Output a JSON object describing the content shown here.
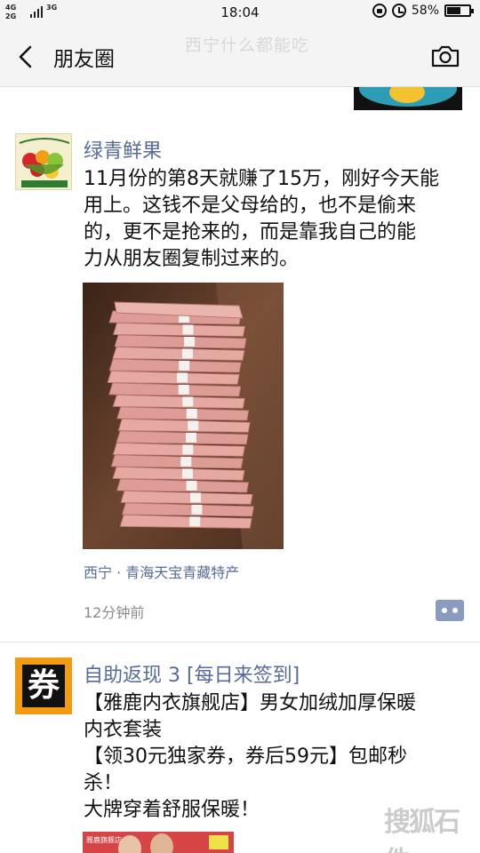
{
  "status_bar": {
    "network_top": "4G",
    "network_bottom": "2G",
    "network_alt": "3G",
    "time": "18:04",
    "battery": "58%",
    "battery_level": 0.58
  },
  "nav": {
    "title": "朋友圈",
    "ghost_text": "西宁什么都能吃",
    "back_icon": "chevron-left-icon",
    "camera_icon": "camera-icon"
  },
  "posts": [
    {
      "author": "绿青鲜果",
      "avatar_icon": "fruit-basket-avatar",
      "lines": [
        "11月份的第8天就赚了15万，刚好今天能",
        "用上。这钱不是父母给的，也不是偷来",
        "的，更不是抢来的，而是靠我自己的能",
        "力从朋友圈复制过来的。"
      ],
      "location": "西宁 · 青海天宝青藏特产",
      "time": "12分钟前"
    },
    {
      "author": "自助返现 3 [每日来签到]",
      "avatar_glyph": "券",
      "lines": [
        "【雅鹿内衣旗舰店】男女加绒加厚保暖",
        "内衣套装",
        "【领30元独家券，券后59元】包邮秒",
        "杀！",
        "大牌穿着舒服保暖！"
      ],
      "banner_tag": "雅鹿旗舰店"
    }
  ],
  "watermark": "搜狐石件",
  "colors": {
    "link": "#576b95",
    "meta": "#8a8a8a",
    "comment_button": "#8a9bbf",
    "coupon_avatar": "#f39a13"
  }
}
